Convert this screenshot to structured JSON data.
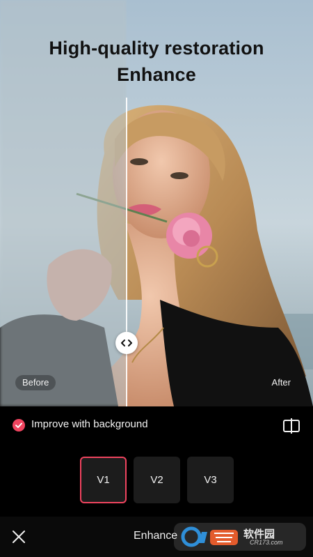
{
  "headline": {
    "line1": "High-quality restoration",
    "line2": "Enhance"
  },
  "compare": {
    "before_label": "Before",
    "after_label": "After",
    "handle_icon": "left-right-arrows-icon"
  },
  "option": {
    "label": "Improve with background",
    "checked": true,
    "check_icon": "checkmark-icon",
    "compare_toggle_icon": "split-compare-icon"
  },
  "versions": [
    {
      "label": "V1",
      "selected": true
    },
    {
      "label": "V2",
      "selected": false
    },
    {
      "label": "V3",
      "selected": false
    }
  ],
  "bottom_bar": {
    "title": "Enhance",
    "close_icon": "close-icon"
  },
  "watermark": {
    "brand": "软件园",
    "url": "CR173.com"
  },
  "colors": {
    "accent": "#f0445f",
    "background": "#000000",
    "tile": "#1c1c1c"
  }
}
